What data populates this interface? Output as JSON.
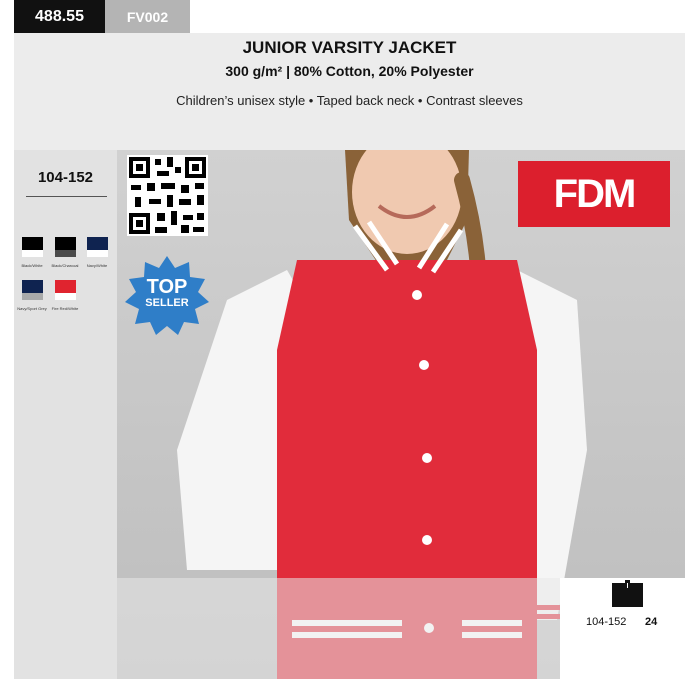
{
  "header": {
    "product_code": "488.55",
    "sku": "FV002",
    "title": "JUNIOR VARSITY JACKET",
    "subtitle": "300 g/m² | 80% Cotton, 20% Polyester",
    "features": "Children’s unisex style • Taped back neck • Contrast sleeves"
  },
  "sidebar": {
    "size_range": "104-152",
    "colors": [
      {
        "label": "Black/White",
        "top": "#000000",
        "bottom": "#ffffff"
      },
      {
        "label": "Black/Charcoal",
        "top": "#000000",
        "bottom": "#4a4a4a"
      },
      {
        "label": "Navy/White",
        "top": "#0f2350",
        "bottom": "#ffffff"
      },
      {
        "label": "Navy/Sport Grey",
        "top": "#0f2350",
        "bottom": "#a9aaaa"
      },
      {
        "label": "Fire Red/White",
        "top": "#e0242f",
        "bottom": "#ffffff"
      }
    ]
  },
  "badges": {
    "brand": "FDM",
    "seller_top": "TOP",
    "seller_bottom": "SELLER",
    "seller_color": "#2f7ec8",
    "brand_color": "#dc1f2d"
  },
  "packaging": {
    "icon": "carton-icon",
    "sizes": "104-152",
    "quantity": "24"
  }
}
